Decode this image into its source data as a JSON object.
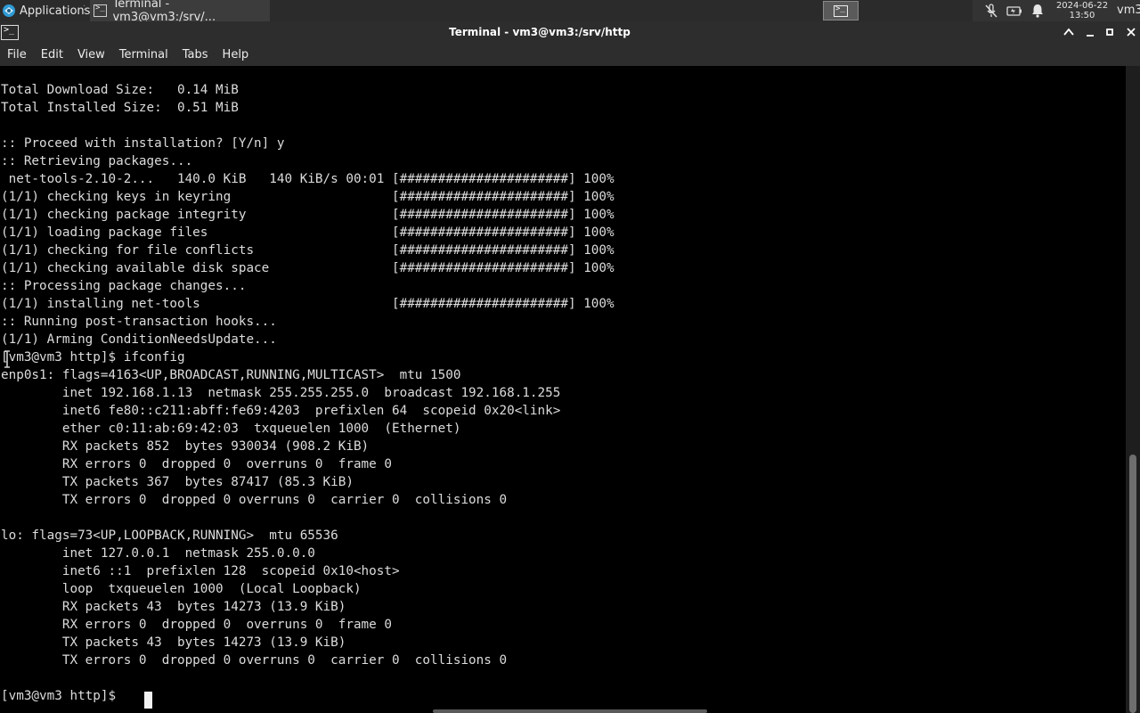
{
  "panel": {
    "app_menu_label": "Applications",
    "task_label": "Terminal - vm3@vm3:/srv/...",
    "clock_date": "2024-06-22",
    "clock_time": "13:50",
    "user": "vm3",
    "icons": [
      "xfce-logo-icon",
      "terminal-icon",
      "mic-muted-icon",
      "battery-icon",
      "notification-bell-icon"
    ]
  },
  "window": {
    "title": "Terminal - vm3@vm3:/srv/http",
    "controls": [
      "maximize-up",
      "minimize",
      "maximize",
      "close"
    ]
  },
  "menubar": {
    "items": [
      "File",
      "Edit",
      "View",
      "Terminal",
      "Tabs",
      "Help"
    ]
  },
  "terminal": {
    "lines": [
      "Total Download Size:   0.14 MiB",
      "Total Installed Size:  0.51 MiB",
      "",
      ":: Proceed with installation? [Y/n] y",
      ":: Retrieving packages...",
      " net-tools-2.10-2...   140.0 KiB   140 KiB/s 00:01 [######################] 100%",
      "(1/1) checking keys in keyring                     [######################] 100%",
      "(1/1) checking package integrity                   [######################] 100%",
      "(1/1) loading package files                        [######################] 100%",
      "(1/1) checking for file conflicts                  [######################] 100%",
      "(1/1) checking available disk space                [######################] 100%",
      ":: Processing package changes...",
      "(1/1) installing net-tools                         [######################] 100%",
      ":: Running post-transaction hooks...",
      "(1/1) Arming ConditionNeedsUpdate...",
      "[vm3@vm3 http]$ ifconfig",
      "enp0s1: flags=4163<UP,BROADCAST,RUNNING,MULTICAST>  mtu 1500",
      "        inet 192.168.1.13  netmask 255.255.255.0  broadcast 192.168.1.255",
      "        inet6 fe80::c211:abff:fe69:4203  prefixlen 64  scopeid 0x20<link>",
      "        ether c0:11:ab:69:42:03  txqueuelen 1000  (Ethernet)",
      "        RX packets 852  bytes 930034 (908.2 KiB)",
      "        RX errors 0  dropped 0  overruns 0  frame 0",
      "        TX packets 367  bytes 87417 (85.3 KiB)",
      "        TX errors 0  dropped 0 overruns 0  carrier 0  collisions 0",
      "",
      "lo: flags=73<UP,LOOPBACK,RUNNING>  mtu 65536",
      "        inet 127.0.0.1  netmask 255.0.0.0",
      "        inet6 ::1  prefixlen 128  scopeid 0x10<host>",
      "        loop  txqueuelen 1000  (Local Loopback)",
      "        RX packets 43  bytes 14273 (13.9 KiB)",
      "        RX errors 0  dropped 0  overruns 0  frame 0",
      "        TX packets 43  bytes 14273 (13.9 KiB)",
      "        TX errors 0  dropped 0 overruns 0  carrier 0  collisions 0",
      "",
      "[vm3@vm3 http]$ "
    ]
  },
  "colors": {
    "panel_bg": "#2b2b2b",
    "titlebar_bg": "#2d2d2d",
    "terminal_bg": "#000000",
    "terminal_fg": "#dcdcdc"
  }
}
